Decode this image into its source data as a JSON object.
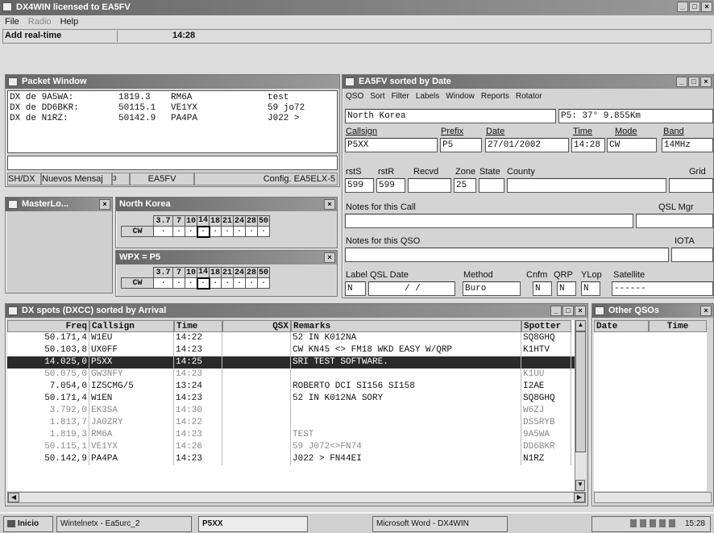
{
  "app": {
    "title": "DX4WIN licensed to EA5FV",
    "menu": [
      "File",
      "Radio",
      "Help"
    ],
    "toolbar": {
      "add_realtime": "Add real-time",
      "clock": "14:28"
    }
  },
  "packet": {
    "title": "Packet Window",
    "lines": [
      {
        "from": "DX de 9A5WA:",
        "freq": "1819.3",
        "call": "RM6A",
        "note": "test"
      },
      {
        "from": "DX de DD6BKR:",
        "freq": "50115.1",
        "call": "VE1YX",
        "note": "59 jo72"
      },
      {
        "from": "DX de N1RZ:",
        "freq": "50142.9",
        "call": "PA4PA",
        "note": "J022 >"
      }
    ],
    "status": [
      "SH/DX",
      "Nuevos Mensaj",
      "3",
      "EA5FV",
      "Config. EA5ELX-5"
    ]
  },
  "masterlog": {
    "title": "MasterLo..."
  },
  "country_grid": {
    "title": "North Korea",
    "bands": [
      "3.7",
      "7",
      "10",
      "14",
      "18",
      "21",
      "24",
      "28",
      "50"
    ],
    "mode": "CW",
    "marks": [
      "·",
      "·",
      "·",
      "·",
      "·",
      "·",
      "·",
      "·",
      "·"
    ]
  },
  "wpx_grid": {
    "title": "WPX = P5",
    "bands": [
      "3.7",
      "7",
      "10",
      "14",
      "18",
      "21",
      "24",
      "28",
      "50"
    ],
    "mode": "CW",
    "marks": [
      "·",
      "·",
      "·",
      "·",
      "·",
      "·",
      "·",
      "·",
      "·"
    ]
  },
  "qso": {
    "title": "EA5FV sorted by Date",
    "menu": [
      "QSO",
      "Sort",
      "Filter",
      "Labels",
      "Window",
      "Reports",
      "Rotator"
    ],
    "country": "North Korea",
    "bearing": "P5: 37° 9.855Km",
    "labels": {
      "callsign": "Callsign",
      "prefix": "Prefix",
      "date": "Date",
      "time": "Time",
      "mode": "Mode",
      "band": "Band",
      "rsts": "rstS",
      "rstr": "rstR",
      "recvd": "Recvd",
      "zone": "Zone",
      "state": "State",
      "county": "County",
      "grid": "Grid",
      "notes_call": "Notes for this Call",
      "qsl_mgr": "QSL Mgr",
      "notes_qso": "Notes for this QSO",
      "iota": "IOTA",
      "label": "Label",
      "qsl_date": "QSL Date",
      "method": "Method",
      "cnfm": "Cnfm",
      "qrp": "QRP",
      "ylop": "YLop",
      "satellite": "Satellite"
    },
    "values": {
      "callsign": "P5XX",
      "prefix": "P5",
      "date": "27/01/2002",
      "time": "14:28",
      "mode": "CW",
      "band": "14MHz",
      "rsts": "599",
      "rstr": "599",
      "zone": "25",
      "label": "N",
      "qsl_date": "/ /",
      "method": "Buro",
      "cnfm": "N",
      "qrp": "N",
      "ylop": "N",
      "satellite": "------"
    }
  },
  "spots": {
    "title": "DX spots (DXCC) sorted by Arrival",
    "columns": [
      "Freq",
      "Callsign",
      "Time",
      "QSX",
      "Remarks",
      "Spotter"
    ],
    "rows": [
      {
        "freq": "50.171,4",
        "call": "W1EU",
        "time": "14:22",
        "qsx": "",
        "remarks": "52 IN K012NA",
        "spotter": "SQ8GHQ",
        "state": "normal"
      },
      {
        "freq": "50.103,8",
        "call": "UX0FF",
        "time": "14:23",
        "qsx": "",
        "remarks": "CW KN45 <> FM18 WKD EASY W/QRP",
        "spotter": "K1HTV",
        "state": "normal"
      },
      {
        "freq": "14.025,0",
        "call": "P5XX",
        "time": "14:25",
        "qsx": "",
        "remarks": "SRI TEST SOFTWARE.",
        "spotter": "",
        "state": "sel"
      },
      {
        "freq": "50.075,0",
        "call": "GW3NFY",
        "time": "14:23",
        "qsx": "",
        "remarks": "",
        "spotter": "K1UU",
        "state": "dim"
      },
      {
        "freq": "7.054,0",
        "call": "IZ5CMG/5",
        "time": "13:24",
        "qsx": "",
        "remarks": "ROBERTO DCI SI156 SI158",
        "spotter": "I2AE",
        "state": "normal"
      },
      {
        "freq": "50.171,4",
        "call": "W1EN",
        "time": "14:23",
        "qsx": "",
        "remarks": "52 IN K012NA  SORY",
        "spotter": "SQ8GHQ",
        "state": "normal"
      },
      {
        "freq": "3.792,0",
        "call": "EK3SA",
        "time": "14:30",
        "qsx": "",
        "remarks": "",
        "spotter": "W6ZJ",
        "state": "dim"
      },
      {
        "freq": "1.813,7",
        "call": "JA0ZRY",
        "time": "14:22",
        "qsx": "",
        "remarks": "",
        "spotter": "DS5RYB",
        "state": "dim"
      },
      {
        "freq": "1.819,3",
        "call": "RM6A",
        "time": "14:23",
        "qsx": "",
        "remarks": "TEST",
        "spotter": "9A5WA",
        "state": "dim"
      },
      {
        "freq": "50.115,1",
        "call": "VE1YX",
        "time": "14:26",
        "qsx": "",
        "remarks": "59 J072<>FN74",
        "spotter": "DD6BKR",
        "state": "dim"
      },
      {
        "freq": "50.142,9",
        "call": "PA4PA",
        "time": "14:23",
        "qsx": "",
        "remarks": "J022 > FN44EI",
        "spotter": "N1RZ",
        "state": "normal"
      }
    ]
  },
  "other": {
    "title": "Other QSOs",
    "columns": [
      "Date",
      "Time"
    ]
  },
  "taskbar": {
    "start": "Inicio",
    "items": [
      "Wintelnetx - Ea5urc_2",
      "P5XX",
      "Microsoft Word - DX4WIN"
    ],
    "clock": "15:28"
  }
}
